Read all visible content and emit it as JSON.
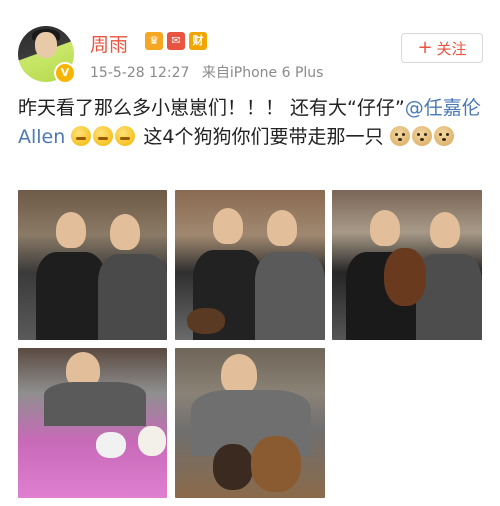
{
  "user": {
    "name": "周雨",
    "verified_badge": "V",
    "badges": [
      "crown-badge",
      "red-envelope-badge",
      "vip-badge"
    ],
    "badge_glyphs": [
      "♛",
      "✉",
      "财"
    ]
  },
  "post_meta": {
    "timestamp": "15-5-28 12:27",
    "source": "来自iPhone 6 Plus"
  },
  "follow_button": {
    "icon": "+",
    "label": "关注"
  },
  "post": {
    "text_part1": "昨天看了那么多小崽崽们！！！ 还有大“仔仔”",
    "mention": "@任嘉伦Allen",
    "text_part2": " 这4个狗狗你们要带走那一只"
  },
  "colors": {
    "username": "#e8543f",
    "mention": "#4b79b4",
    "meta": "#8a8a8a",
    "follow": "#e8543f"
  },
  "photos_count": 5
}
